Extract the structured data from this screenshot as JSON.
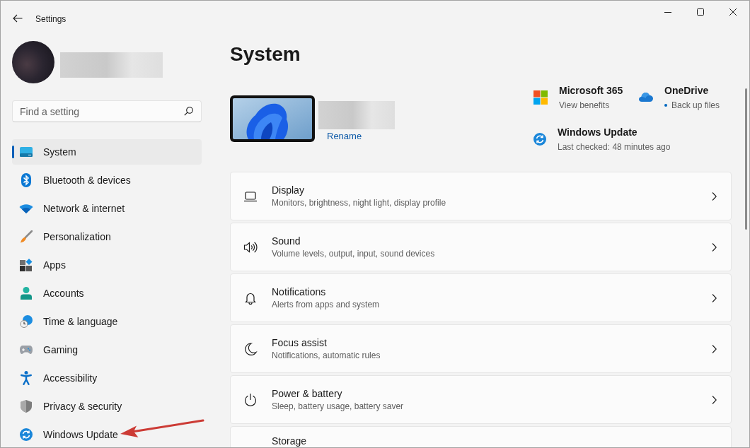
{
  "window": {
    "title": "Settings"
  },
  "search": {
    "placeholder": "Find a setting"
  },
  "sidebar": {
    "items": [
      {
        "label": "System",
        "selected": true
      },
      {
        "label": "Bluetooth & devices",
        "selected": false
      },
      {
        "label": "Network & internet",
        "selected": false
      },
      {
        "label": "Personalization",
        "selected": false
      },
      {
        "label": "Apps",
        "selected": false
      },
      {
        "label": "Accounts",
        "selected": false
      },
      {
        "label": "Time & language",
        "selected": false
      },
      {
        "label": "Gaming",
        "selected": false
      },
      {
        "label": "Accessibility",
        "selected": false
      },
      {
        "label": "Privacy & security",
        "selected": false
      },
      {
        "label": "Windows Update",
        "selected": false
      }
    ]
  },
  "page": {
    "title": "System"
  },
  "device": {
    "rename": "Rename"
  },
  "quick_links": [
    {
      "title": "Microsoft 365",
      "subtitle": "View benefits",
      "dot": false
    },
    {
      "title": "OneDrive",
      "subtitle": "Back up files",
      "dot": true
    },
    {
      "title": "Windows Update",
      "subtitle": "Last checked: 48 minutes ago",
      "dot": false
    }
  ],
  "cards": [
    {
      "title": "Display",
      "description": "Monitors, brightness, night light, display profile"
    },
    {
      "title": "Sound",
      "description": "Volume levels, output, input, sound devices"
    },
    {
      "title": "Notifications",
      "description": "Alerts from apps and system"
    },
    {
      "title": "Focus assist",
      "description": "Notifications, automatic rules"
    },
    {
      "title": "Power & battery",
      "description": "Sleep, battery usage, battery saver"
    },
    {
      "title": "Storage"
    }
  ]
}
